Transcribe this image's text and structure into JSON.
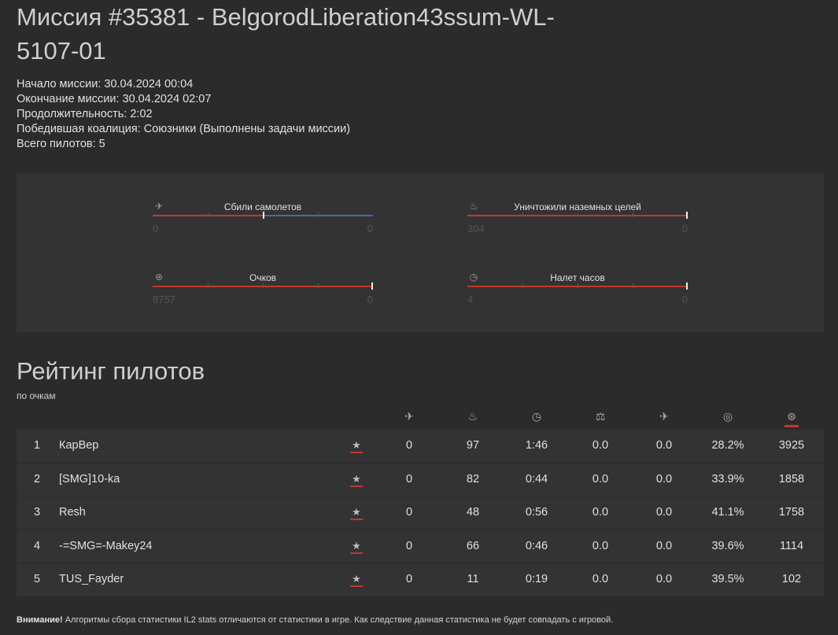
{
  "mission": {
    "title": "Миссия #35381 - BelgorodLiberation43ssum-WL-5107-01",
    "start": "Начало миссии: 30.04.2024 00:04",
    "end": "Окончание миссии: 30.04.2024 02:07",
    "duration": "Продолжительность: 2:02",
    "winner": "Победившая коалиция: Союзники (Выполнены задачи миссии)",
    "pilots": "Всего пилотов: 5"
  },
  "stats": [
    {
      "icon": "plane-icon",
      "label": "Сбили самолетов",
      "left": "0",
      "right": "0",
      "left_fraction": 0.5
    },
    {
      "icon": "fire-icon",
      "label": "Уничтожили наземных целей",
      "left": "304",
      "right": "0",
      "left_fraction": 1.0
    },
    {
      "icon": "medal-icon",
      "label": "Очков",
      "left": "8757",
      "right": "0",
      "left_fraction": 1.0
    },
    {
      "icon": "clock-icon",
      "label": "Налет часов",
      "left": "4",
      "right": "0",
      "left_fraction": 1.0
    }
  ],
  "rating": {
    "title": "Рейтинг пилотов",
    "subtitle": "по очкам",
    "columns": [
      "plane-icon",
      "fire-icon",
      "clock-icon",
      "scales-icon",
      "plane-crash-icon",
      "target-icon",
      "medal-icon"
    ],
    "active_column": "medal-icon",
    "rows": [
      {
        "rank": "1",
        "name": "КарВер",
        "v": [
          "0",
          "97",
          "1:46",
          "0.0",
          "0.0",
          "28.2%",
          "3925"
        ]
      },
      {
        "rank": "2",
        "name": "[SMG]10-ka",
        "v": [
          "0",
          "82",
          "0:44",
          "0.0",
          "0.0",
          "33.9%",
          "1858"
        ]
      },
      {
        "rank": "3",
        "name": "Resh",
        "v": [
          "0",
          "48",
          "0:56",
          "0.0",
          "0.0",
          "41.1%",
          "1758"
        ]
      },
      {
        "rank": "4",
        "name": "-=SMG=-Makey24",
        "v": [
          "0",
          "66",
          "0:46",
          "0.0",
          "0.0",
          "39.6%",
          "1114"
        ]
      },
      {
        "rank": "5",
        "name": "TUS_Fayder",
        "v": [
          "0",
          "11",
          "0:19",
          "0.0",
          "0.0",
          "39.5%",
          "102"
        ]
      }
    ]
  },
  "footer": {
    "bold": "Внимание!",
    "text": " Алгоритмы сбора статистики IL2 stats отличаются от статистики в игре. Как следствие данная статистика не будет совпадать с игровой."
  },
  "colors": {
    "accent": "#c0392b",
    "blue": "#3a6fb0",
    "background": "#2b2b2b",
    "panel": "#333333"
  }
}
